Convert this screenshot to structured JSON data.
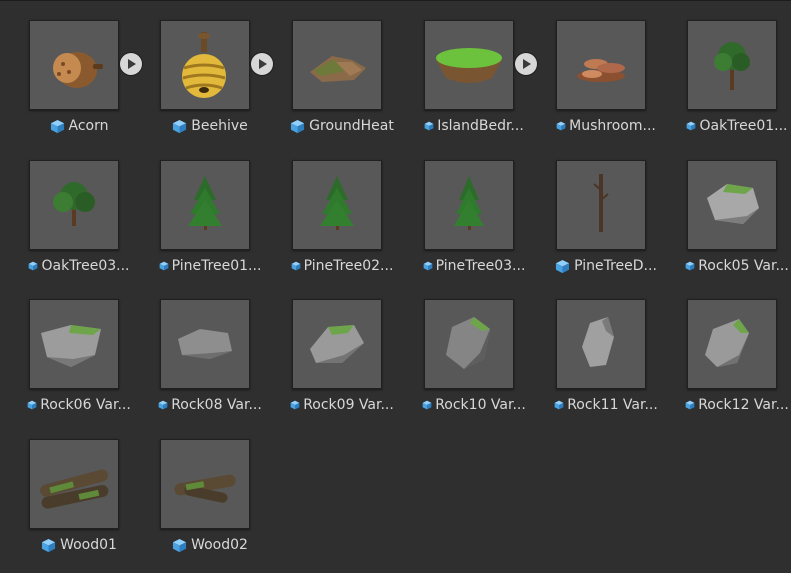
{
  "assets": [
    {
      "label": "Acorn",
      "icon": "cube-icon",
      "thumb": "acorn-thumb",
      "has_play": true
    },
    {
      "label": "Beehive",
      "icon": "cube-icon",
      "thumb": "beehive-thumb",
      "has_play": true
    },
    {
      "label": "GroundHeat",
      "icon": "cube-icon",
      "thumb": "groundheat-thumb",
      "has_play": false
    },
    {
      "label": "IslandBedr...",
      "icon": "cube-icon",
      "thumb": "island-thumb",
      "has_play": true
    },
    {
      "label": "Mushroom...",
      "icon": "cube-icon",
      "thumb": "mushroom-thumb",
      "has_play": false
    },
    {
      "label": "OakTree01...",
      "icon": "cube-icon",
      "thumb": "oaktree-thumb",
      "has_play": false
    },
    {
      "label": "OakTree03...",
      "icon": "cube-icon",
      "thumb": "oaktree-thumb",
      "has_play": false
    },
    {
      "label": "PineTree01...",
      "icon": "cube-icon",
      "thumb": "pinetree-thumb",
      "has_play": false
    },
    {
      "label": "PineTree02...",
      "icon": "cube-icon",
      "thumb": "pinetree-thumb",
      "has_play": false
    },
    {
      "label": "PineTree03...",
      "icon": "cube-icon",
      "thumb": "pinetree-thumb",
      "has_play": false
    },
    {
      "label": "PineTreeD...",
      "icon": "cube-icon",
      "thumb": "deadtree-thumb",
      "has_play": false
    },
    {
      "label": "Rock05 Var...",
      "icon": "cube-icon",
      "thumb": "rock-thumb",
      "has_play": false
    },
    {
      "label": "Rock06 Var...",
      "icon": "cube-icon",
      "thumb": "rock-thumb",
      "has_play": false
    },
    {
      "label": "Rock08 Var...",
      "icon": "cube-icon",
      "thumb": "rock-thumb",
      "has_play": false
    },
    {
      "label": "Rock09 Var...",
      "icon": "cube-icon",
      "thumb": "rock-thumb",
      "has_play": false
    },
    {
      "label": "Rock10 Var...",
      "icon": "cube-icon",
      "thumb": "rock-thumb",
      "has_play": false
    },
    {
      "label": "Rock11 Var...",
      "icon": "cube-icon",
      "thumb": "rock-thumb",
      "has_play": false
    },
    {
      "label": "Rock12 Var...",
      "icon": "cube-icon",
      "thumb": "rock-thumb",
      "has_play": false
    },
    {
      "label": "Wood01",
      "icon": "cube-icon",
      "thumb": "wood-thumb",
      "has_play": false
    },
    {
      "label": "Wood02",
      "icon": "cube-icon",
      "thumb": "wood-thumb",
      "has_play": false
    }
  ],
  "colors": {
    "background": "#2f2f2f",
    "thumb_bg": "#585858",
    "label_text": "#d8d8d8",
    "cube_icon": "#5bb4f0"
  }
}
